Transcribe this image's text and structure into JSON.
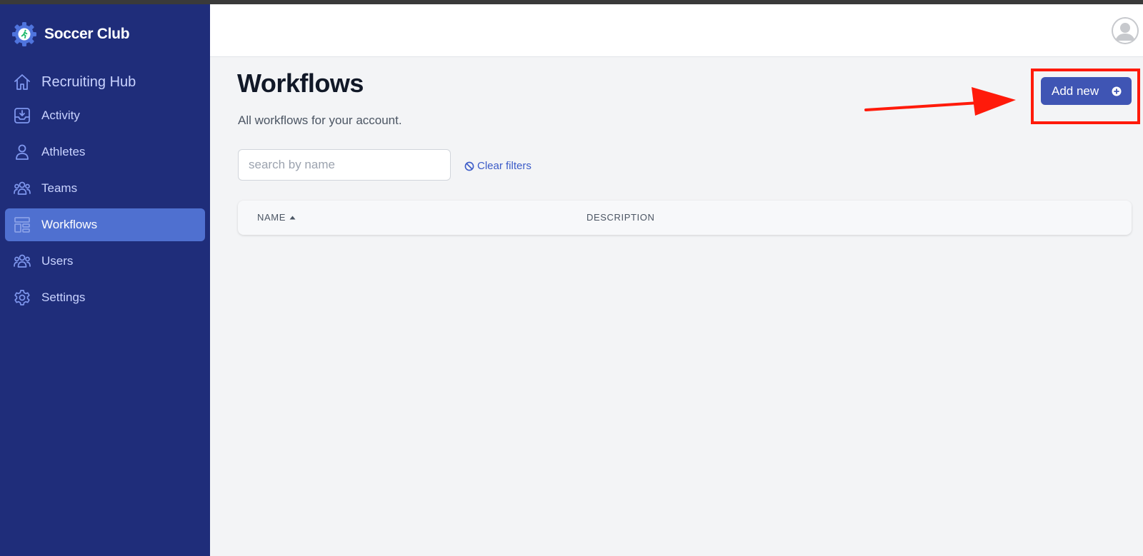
{
  "brand": {
    "name": "Soccer Club",
    "logo_icon": "gear-runner-logo-icon"
  },
  "sidebar": {
    "items": [
      {
        "label": "Recruiting Hub",
        "icon": "home-icon",
        "active": false
      },
      {
        "label": "Activity",
        "icon": "inbox-download-icon",
        "active": false
      },
      {
        "label": "Athletes",
        "icon": "user-icon",
        "active": false
      },
      {
        "label": "Teams",
        "icon": "users-group-icon",
        "active": false
      },
      {
        "label": "Workflows",
        "icon": "template-icon",
        "active": true
      },
      {
        "label": "Users",
        "icon": "users-group-icon",
        "active": false
      },
      {
        "label": "Settings",
        "icon": "gear-icon",
        "active": false
      }
    ]
  },
  "header": {
    "avatar_icon": "user-avatar-icon"
  },
  "page": {
    "title": "Workflows",
    "subtitle": "All workflows for your account.",
    "add_button_label": "Add new"
  },
  "filters": {
    "search_placeholder": "search by name",
    "search_value": "",
    "clear_label": "Clear filters"
  },
  "table": {
    "columns": [
      {
        "label": "NAME",
        "sorted": "asc"
      },
      {
        "label": "DESCRIPTION"
      }
    ],
    "rows": []
  },
  "colors": {
    "sidebar_bg": "#1f2d7a",
    "active_item_bg": "#4f70d0",
    "accent": "#3f55b4",
    "annotation_red": "#ff1a0a"
  }
}
